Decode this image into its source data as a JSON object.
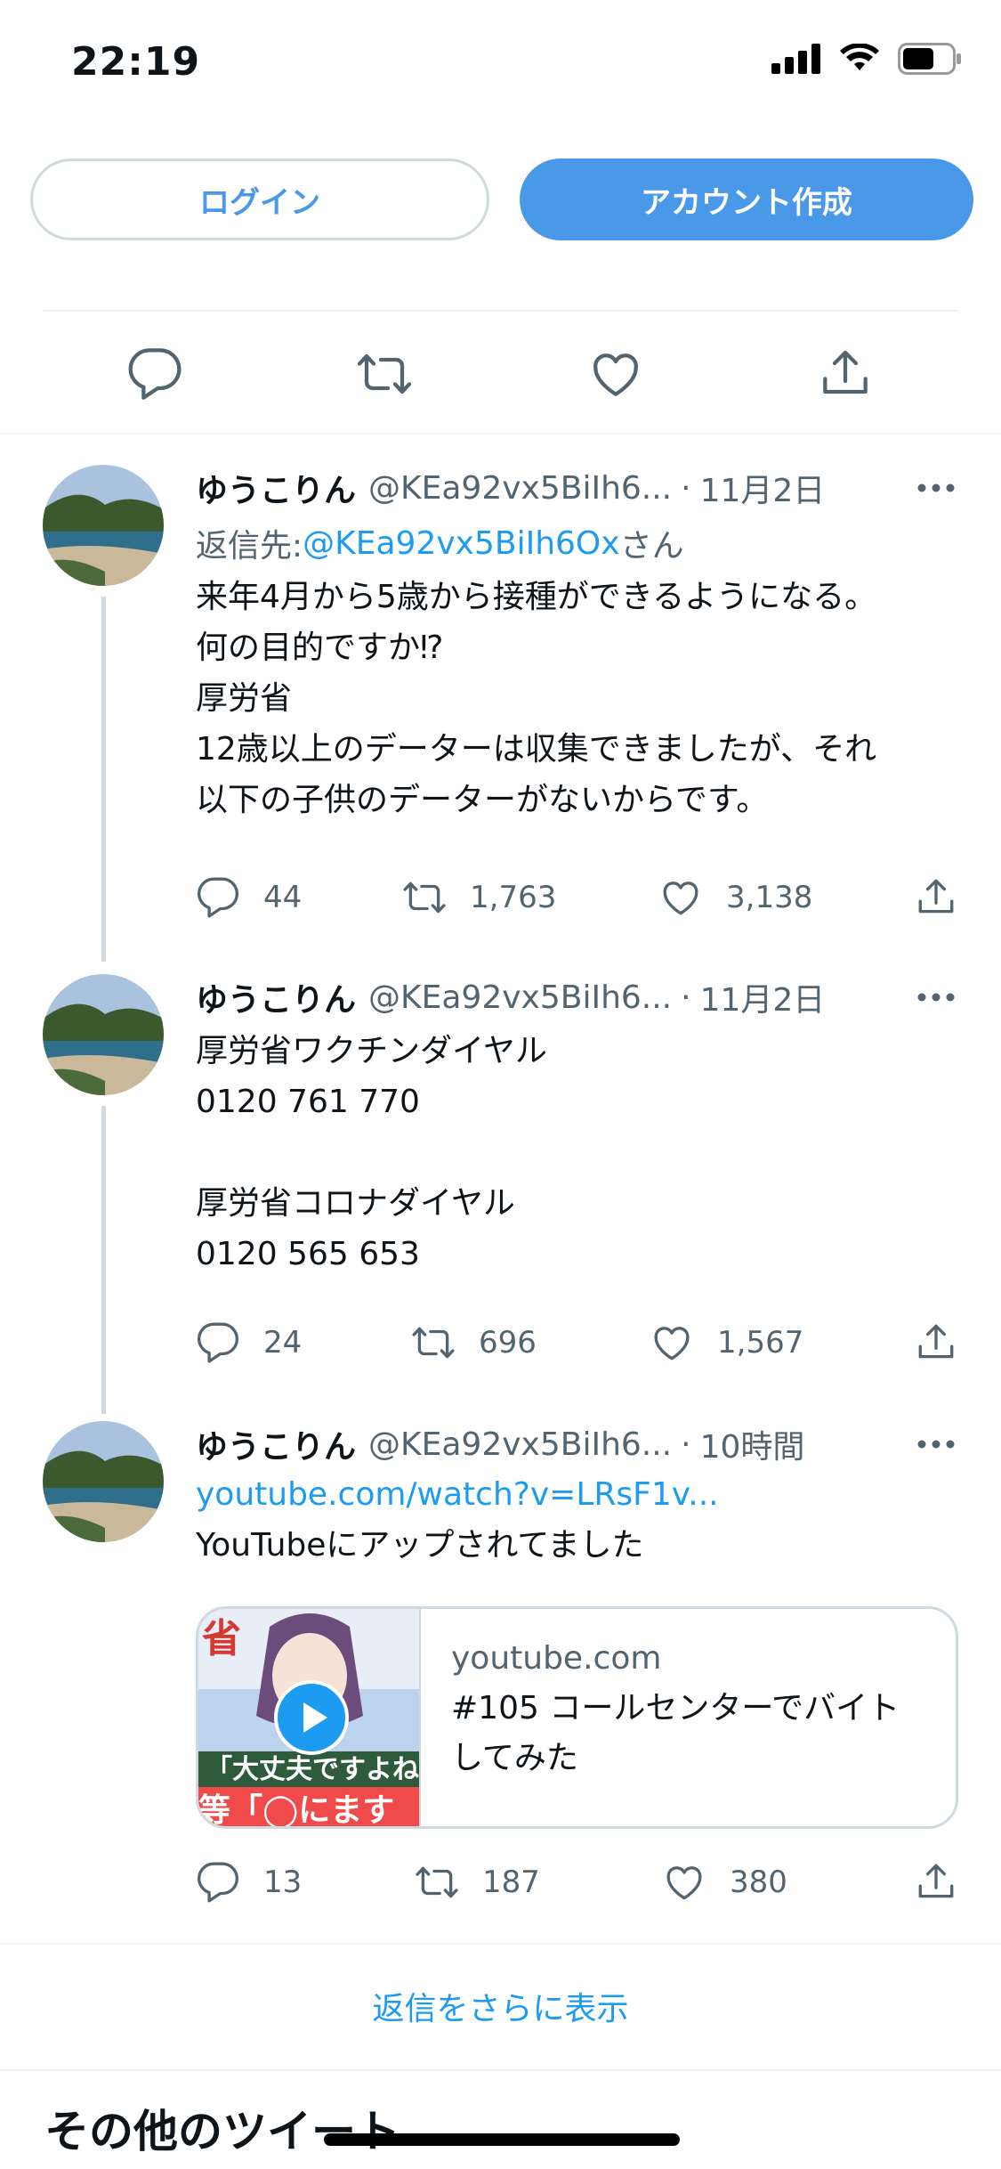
{
  "status": {
    "time": "22:19"
  },
  "auth": {
    "login": "ログイン",
    "signup": "アカウント作成"
  },
  "tweets": [
    {
      "name": "ゆうこりん",
      "handle": "@KEa92vx5BiIh6...",
      "dot": "·",
      "time": "11月2日",
      "reply_prefix": "返信先: ",
      "reply_handle": "@KEa92vx5BiIh6Ox",
      "reply_suffix": "さん",
      "text": "来年4月から5歳から接種ができるようになる。\n何の目的ですか⁉\n厚労省\n12歳以上のデーターは収集できましたが、それ\n以下の子供のデーターがないからです。",
      "replies": "44",
      "retweets": "1,763",
      "likes": "3,138"
    },
    {
      "name": "ゆうこりん",
      "handle": "@KEa92vx5BiIh6...",
      "dot": "·",
      "time": "11月2日",
      "text": "厚労省ワクチンダイヤル\n0120 761 770\n\n厚労省コロナダイヤル\n0120 565 653",
      "replies": "24",
      "retweets": "696",
      "likes": "1,567"
    },
    {
      "name": "ゆうこりん",
      "handle": "@KEa92vx5BiIh6...",
      "dot": "·",
      "time": "10時間",
      "link": "youtube.com/watch?v=LRsF1v...",
      "text": "YouTubeにアップされてました",
      "card": {
        "domain": "youtube.com",
        "title": "#105 コールセンターでバイトしてみた",
        "thumb_text_1": "省",
        "thumb_text_2": "「大丈夫ですよね",
        "thumb_text_3": "等「◯にます"
      },
      "replies": "13",
      "retweets": "187",
      "likes": "380"
    }
  ],
  "more_replies": "返信をさらに表示",
  "other_tweets_title": "その他のツイート",
  "colors": {
    "accent": "#1d9bf0",
    "button": "#4a99e9",
    "muted": "#536471",
    "border": "#cfd9de"
  }
}
